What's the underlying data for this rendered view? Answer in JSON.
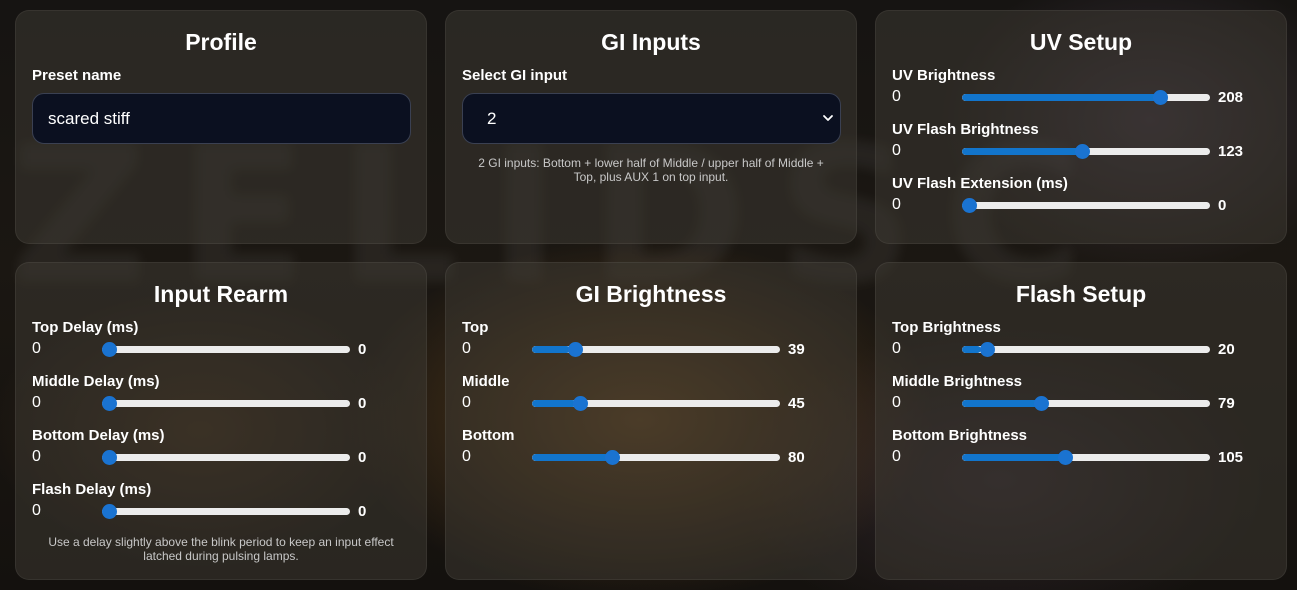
{
  "colors": {
    "accent": "#1275cc",
    "card_bg": "#3c3832",
    "input_bg": "#0b1020"
  },
  "profile": {
    "title": "Profile",
    "preset_label": "Preset name",
    "preset_value": "scared stiff"
  },
  "gi_inputs": {
    "title": "GI Inputs",
    "select_label": "Select GI input",
    "selected_value": "2",
    "hint": "2 GI inputs: Bottom + lower half of Middle / upper half of Middle + Top, plus AUX 1 on top input."
  },
  "uv_setup": {
    "title": "UV Setup",
    "sliders": [
      {
        "label": "UV Brightness",
        "min": "0",
        "value": 208,
        "max": 255
      },
      {
        "label": "UV Flash Brightness",
        "min": "0",
        "value": 123,
        "max": 255
      },
      {
        "label": "UV Flash Extension (ms)",
        "min": "0",
        "value": 0,
        "max": 1000
      }
    ]
  },
  "input_rearm": {
    "title": "Input Rearm",
    "sliders": [
      {
        "label": "Top Delay (ms)",
        "min": "0",
        "value": 0,
        "max": 1000
      },
      {
        "label": "Middle Delay (ms)",
        "min": "0",
        "value": 0,
        "max": 1000
      },
      {
        "label": "Bottom Delay (ms)",
        "min": "0",
        "value": 0,
        "max": 1000
      },
      {
        "label": "Flash Delay (ms)",
        "min": "0",
        "value": 0,
        "max": 1000
      }
    ],
    "hint": "Use a delay slightly above the blink period to keep an input effect latched during pulsing lamps."
  },
  "gi_brightness": {
    "title": "GI Brightness",
    "sliders": [
      {
        "label": "Top",
        "min": "0",
        "value": 39,
        "max": 255
      },
      {
        "label": "Middle",
        "min": "0",
        "value": 45,
        "max": 255
      },
      {
        "label": "Bottom",
        "min": "0",
        "value": 80,
        "max": 255
      }
    ]
  },
  "flash_setup": {
    "title": "Flash Setup",
    "sliders": [
      {
        "label": "Top Brightness",
        "min": "0",
        "value": 20,
        "max": 255
      },
      {
        "label": "Middle Brightness",
        "min": "0",
        "value": 79,
        "max": 255
      },
      {
        "label": "Bottom Brightness",
        "min": "0",
        "value": 105,
        "max": 255
      }
    ]
  }
}
